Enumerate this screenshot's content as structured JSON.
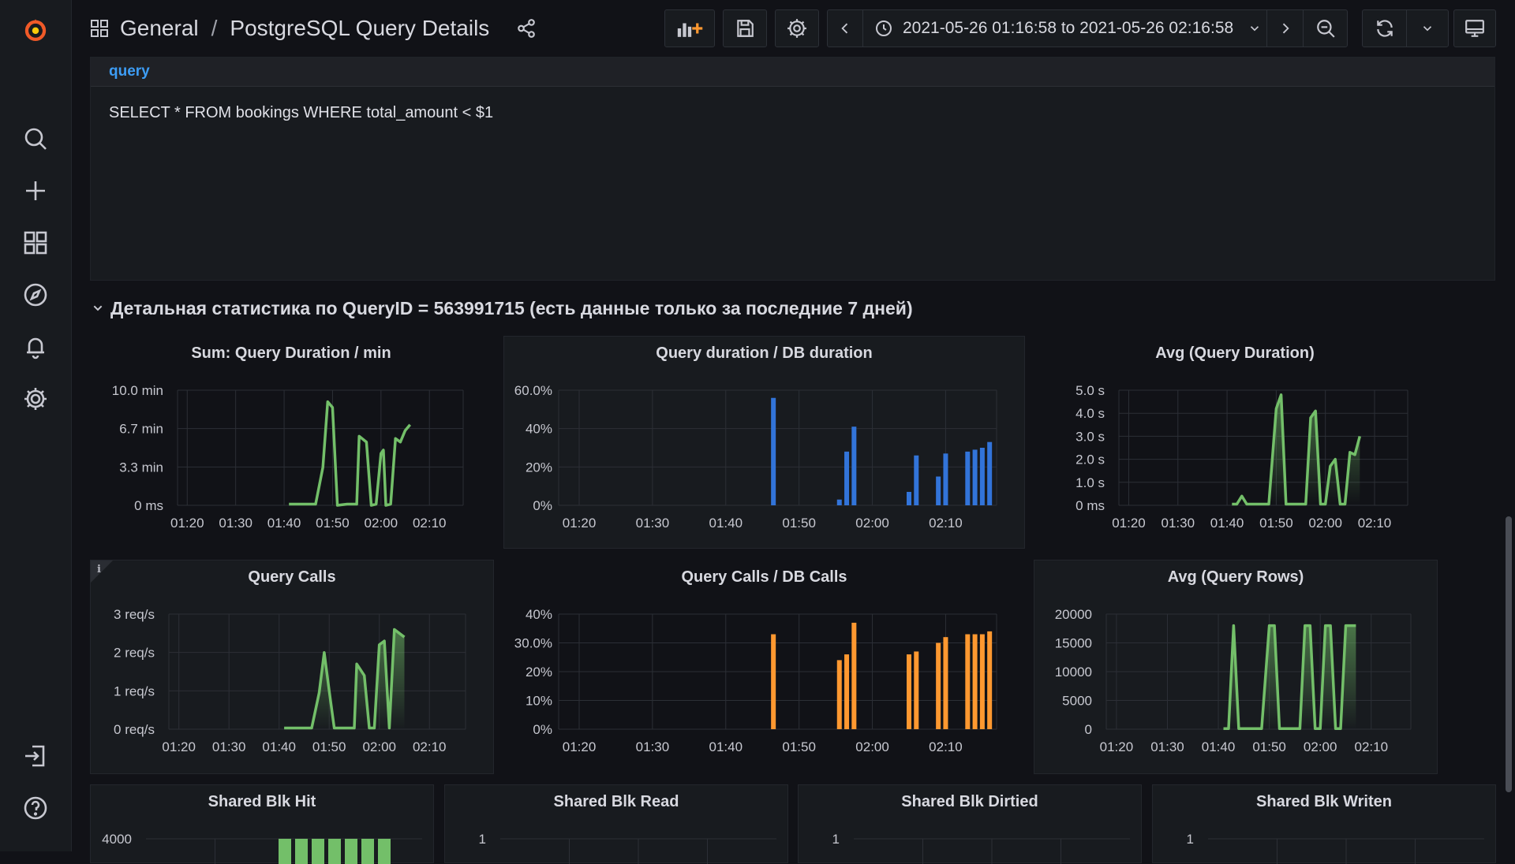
{
  "breadcrumb": {
    "folder": "General",
    "separator": "/",
    "dashboard": "PostgreSQL Query Details"
  },
  "time_range": {
    "label": "2021-05-26 01:16:58 to 2021-05-26 02:16:58"
  },
  "icons": {
    "logo": "grafana-logo-icon",
    "search": "search-icon",
    "create": "plus-icon",
    "dashboards": "grid-icon",
    "explore": "compass-icon",
    "alerting": "bell-icon",
    "configuration": "gear-icon",
    "signin": "sign-in-icon",
    "help": "help-icon"
  },
  "colors": {
    "green": "#73bf69",
    "blue": "#3274d9",
    "orange": "#ff9830",
    "link": "#3d9df5",
    "logo": "#f05a28"
  },
  "query_panel": {
    "title": "query",
    "text": "SELECT * FROM bookings WHERE total_amount < $1"
  },
  "row": {
    "title": "Детальная статистика по QueryID = 563991715 (есть данные только за последние 7 дней)"
  },
  "panels": {
    "p1": {
      "title": "Sum: Query Duration / min"
    },
    "p2": {
      "title": "Query duration / DB duration"
    },
    "p3": {
      "title": "Avg (Query Duration)"
    },
    "p4": {
      "title": "Query Calls",
      "info": "i"
    },
    "p5": {
      "title": "Query Calls / DB Calls"
    },
    "p6": {
      "title": "Avg (Query Rows)"
    },
    "p7": {
      "title": "Shared Blk Hit"
    },
    "p8": {
      "title": "Shared Blk Read"
    },
    "p9": {
      "title": "Shared Blk Dirtied"
    },
    "p10": {
      "title": "Shared Blk Writen"
    }
  },
  "chart_data": [
    {
      "panel": "p1",
      "type": "line",
      "color": "green",
      "fill": false,
      "x_ticks": [
        "01:20",
        "01:30",
        "01:40",
        "01:50",
        "02:00",
        "02:10"
      ],
      "x_range": [
        78.0,
        136.97
      ],
      "y_ticks": [
        "10.0 min",
        "6.7 min",
        "3.3 min",
        "0 ms"
      ],
      "ylim": [
        0,
        10
      ],
      "series": [
        {
          "points": [
            [
              101,
              0.1
            ],
            [
              106,
              0.1
            ],
            [
              106.5,
              0.1
            ],
            [
              108,
              3.3
            ],
            [
              109,
              9
            ],
            [
              110,
              8.5
            ],
            [
              111,
              0
            ],
            [
              113,
              0.1
            ],
            [
              115,
              0.1
            ],
            [
              115.5,
              6
            ],
            [
              117,
              5.5
            ],
            [
              118,
              0
            ],
            [
              119,
              0.1
            ],
            [
              120,
              4.5
            ],
            [
              120.5,
              4.8
            ],
            [
              121,
              0
            ],
            [
              122,
              0.1
            ],
            [
              123,
              5.8
            ],
            [
              124,
              5.5
            ],
            [
              125,
              6.5
            ],
            [
              126,
              7
            ]
          ]
        }
      ]
    },
    {
      "panel": "p2",
      "type": "bar",
      "color": "blue",
      "x_ticks": [
        "01:20",
        "01:30",
        "01:40",
        "01:50",
        "02:00",
        "02:10"
      ],
      "x_range": [
        77.2,
        136.95
      ],
      "y_ticks": [
        "60.0%",
        "40%",
        "20%",
        "0%"
      ],
      "ylim": [
        0,
        60
      ],
      "series": [
        {
          "points": [
            [
              106.5,
              56
            ],
            [
              115.5,
              3
            ],
            [
              116.5,
              28
            ],
            [
              117.5,
              41
            ],
            [
              125,
              7
            ],
            [
              126,
              26
            ],
            [
              129,
              15
            ],
            [
              130,
              27
            ],
            [
              133,
              28
            ],
            [
              134,
              29
            ],
            [
              135,
              30
            ],
            [
              136,
              33
            ]
          ]
        }
      ]
    },
    {
      "panel": "p3",
      "type": "area",
      "color": "green",
      "x_ticks": [
        "01:20",
        "01:30",
        "01:40",
        "01:50",
        "02:00",
        "02:10"
      ],
      "x_range": [
        78.0,
        136.74
      ],
      "y_ticks": [
        "5.0 s",
        "4.0 s",
        "3.0 s",
        "2.0 s",
        "1.0 s",
        "0 ms"
      ],
      "ylim": [
        0,
        5
      ],
      "series": [
        {
          "points": [
            [
              101,
              0.05
            ],
            [
              102,
              0.05
            ],
            [
              103,
              0.4
            ],
            [
              104,
              0.05
            ],
            [
              108,
              0.05
            ],
            [
              108.5,
              0.05
            ],
            [
              110,
              4.2
            ],
            [
              111,
              4.8
            ],
            [
              112,
              0.05
            ],
            [
              115,
              0.05
            ],
            [
              116,
              0.05
            ],
            [
              117,
              3.8
            ],
            [
              118,
              4.1
            ],
            [
              119,
              0.05
            ],
            [
              120,
              0.05
            ],
            [
              121,
              1.7
            ],
            [
              122,
              2
            ],
            [
              123,
              0.05
            ],
            [
              124,
              0.05
            ],
            [
              125,
              2.3
            ],
            [
              126,
              2.2
            ],
            [
              127,
              3
            ]
          ]
        }
      ]
    },
    {
      "panel": "p4",
      "type": "area",
      "color": "green",
      "x_ticks": [
        "01:20",
        "01:30",
        "01:40",
        "01:50",
        "02:00",
        "02:10"
      ],
      "x_range": [
        78.0,
        137.21
      ],
      "y_ticks": [
        "3 req/s",
        "2 req/s",
        "1 req/s",
        "0 req/s"
      ],
      "ylim": [
        0,
        3
      ],
      "series": [
        {
          "points": [
            [
              101,
              0.03
            ],
            [
              106,
              0.03
            ],
            [
              106.5,
              0.03
            ],
            [
              108,
              0.95
            ],
            [
              109,
              2
            ],
            [
              110,
              1
            ],
            [
              111,
              0.03
            ],
            [
              113,
              0.03
            ],
            [
              115,
              0.03
            ],
            [
              115.5,
              1.7
            ],
            [
              117,
              1.4
            ],
            [
              118,
              0.03
            ],
            [
              119,
              0.03
            ],
            [
              120,
              2.2
            ],
            [
              121,
              2.3
            ],
            [
              122,
              0.03
            ],
            [
              123,
              2.6
            ],
            [
              124,
              2.5
            ],
            [
              125,
              2.4
            ]
          ]
        }
      ]
    },
    {
      "panel": "p5",
      "type": "bar",
      "color": "orange",
      "x_ticks": [
        "01:20",
        "01:30",
        "01:40",
        "01:50",
        "02:00",
        "02:10"
      ],
      "x_range": [
        77.2,
        136.95
      ],
      "y_ticks": [
        "40%",
        "30.0%",
        "20%",
        "10%",
        "0%"
      ],
      "ylim": [
        0,
        40
      ],
      "series": [
        {
          "points": [
            [
              106.5,
              33
            ],
            [
              115.5,
              24
            ],
            [
              116.5,
              26
            ],
            [
              117.5,
              37
            ],
            [
              125,
              26
            ],
            [
              126,
              27
            ],
            [
              129,
              30
            ],
            [
              130,
              32
            ],
            [
              133,
              33
            ],
            [
              134,
              33
            ],
            [
              135,
              33
            ],
            [
              136,
              34
            ]
          ]
        }
      ]
    },
    {
      "panel": "p6",
      "type": "area",
      "color": "green",
      "x_ticks": [
        "01:20",
        "01:30",
        "01:40",
        "01:50",
        "02:00",
        "02:10"
      ],
      "x_range": [
        78.0,
        137.78
      ],
      "y_ticks": [
        "20000",
        "15000",
        "10000",
        "5000",
        "0"
      ],
      "ylim": [
        0,
        20000
      ],
      "series": [
        {
          "points": [
            [
              101,
              100
            ],
            [
              102,
              100
            ],
            [
              103,
              18000
            ],
            [
              104,
              100
            ],
            [
              108,
              100
            ],
            [
              108.5,
              100
            ],
            [
              110,
              18000
            ],
            [
              111,
              18000
            ],
            [
              112,
              100
            ],
            [
              115,
              100
            ],
            [
              116,
              100
            ],
            [
              117,
              18000
            ],
            [
              118,
              18000
            ],
            [
              119,
              100
            ],
            [
              120,
              100
            ],
            [
              121,
              18000
            ],
            [
              122,
              18000
            ],
            [
              123,
              100
            ],
            [
              124,
              100
            ],
            [
              125,
              18000
            ],
            [
              126,
              18000
            ],
            [
              127,
              18000
            ]
          ]
        }
      ]
    },
    {
      "panel": "p7",
      "type": "bar",
      "color": "green",
      "y_ticks": [
        "4000"
      ],
      "series": [
        {
          "points": [
            [
              1,
              4000
            ],
            [
              2,
              4000
            ],
            [
              3,
              4000
            ],
            [
              4,
              4000
            ],
            [
              5,
              4000
            ],
            [
              6,
              4000
            ],
            [
              7,
              4000
            ]
          ]
        }
      ]
    },
    {
      "panel": "p8",
      "type": "line",
      "y_ticks": [
        "1"
      ],
      "series": []
    },
    {
      "panel": "p9",
      "type": "line",
      "y_ticks": [
        "1"
      ],
      "series": []
    },
    {
      "panel": "p10",
      "type": "line",
      "y_ticks": [
        "1"
      ],
      "series": []
    }
  ]
}
